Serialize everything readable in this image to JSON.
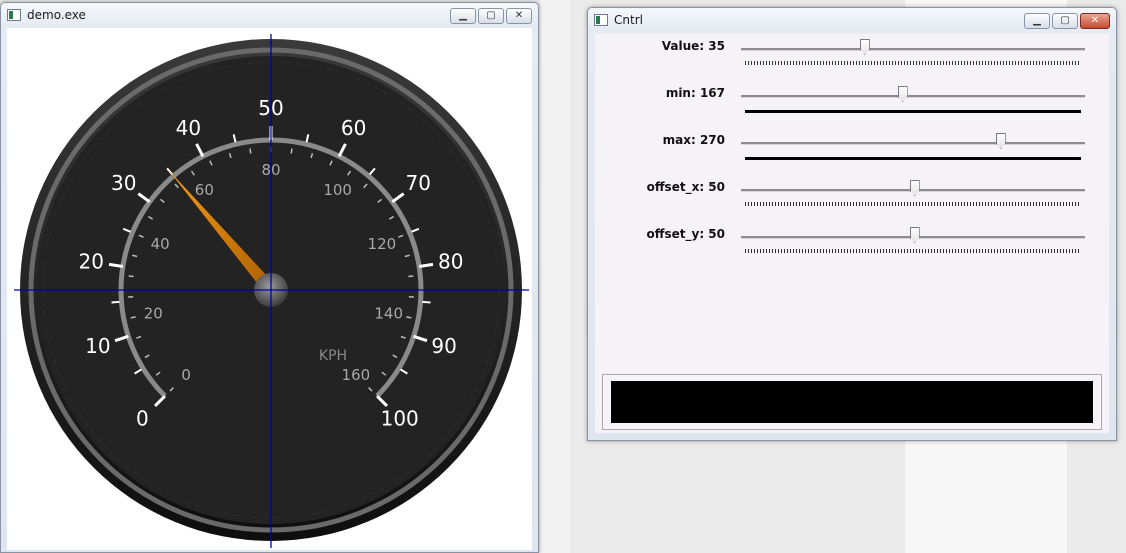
{
  "demo_window": {
    "title": "demo.exe",
    "gauge": {
      "outer_scale_labels": [
        "0",
        "10",
        "20",
        "30",
        "40",
        "50",
        "60",
        "70",
        "80",
        "90",
        "100"
      ],
      "inner_scale_labels": [
        "0",
        "20",
        "40",
        "60",
        "80",
        "100",
        "120",
        "140",
        "160"
      ],
      "unit": "KPH",
      "needle_value": 35,
      "outer_min": 0,
      "outer_max": 100,
      "colors": {
        "dial": "#222222",
        "needle": "#d67e00",
        "crosshair": "#0000b4",
        "arc": "#8a8a8a"
      }
    }
  },
  "cntrl_window": {
    "title": "Cntrl",
    "trackbars": [
      {
        "label": "Value: 35",
        "fraction": 0.36,
        "underline": "ticks"
      },
      {
        "label": "min: 167",
        "fraction": 0.47,
        "underline": "solid"
      },
      {
        "label": "max: 270",
        "fraction": 0.755,
        "underline": "solid"
      },
      {
        "label": "offset_x: 50",
        "fraction": 0.505,
        "underline": "ticks"
      },
      {
        "label": "offset_y: 50",
        "fraction": 0.505,
        "underline": "ticks"
      }
    ]
  }
}
